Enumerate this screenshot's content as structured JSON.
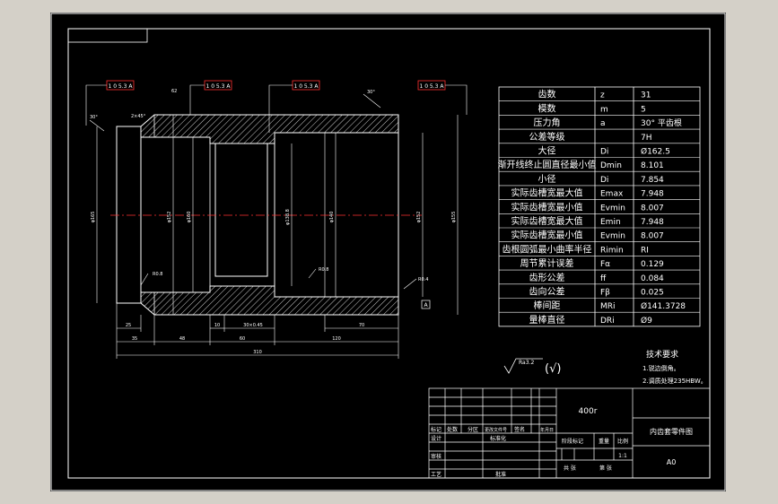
{
  "colors": {
    "background": "#000000",
    "line": "#ffffff",
    "center_line": "#ff0000",
    "tag_border": "#ff0000",
    "window_frame": "#d4d0c8"
  },
  "callouts": [
    "1 0 5.3 A",
    "1 0 5.3 A",
    "1 0 5.3 A",
    "1 0 5.3 A"
  ],
  "drawing_annotations": {
    "angle_left": "30°",
    "angle_right": "30°",
    "chamfer_left": "2×45°",
    "top_dim": "62",
    "r1": "R0.8",
    "r2": "R0.8",
    "r3": "R0.4",
    "datum": "A"
  },
  "dimensions": {
    "vertical": [
      "φ165",
      "φ152",
      "φ160",
      "φ138.8",
      "φ140",
      "φ152",
      "φ155"
    ],
    "horizontal": [
      "25",
      "35",
      "48",
      "60",
      "10",
      "30×0.45",
      "120",
      "70",
      "310"
    ]
  },
  "spec_table": [
    [
      "齿数",
      "z",
      "31"
    ],
    [
      "模数",
      "m",
      "5"
    ],
    [
      "压力角",
      "a",
      "30° 平齿根"
    ],
    [
      "公差等级",
      "",
      "7H"
    ],
    [
      "大径",
      "Di",
      "Ø162.5"
    ],
    [
      "渐开线终止圆直径最小值",
      "Dmin",
      "8.101"
    ],
    [
      "小径",
      "Di",
      "7.854"
    ],
    [
      "实际齿槽宽最大值",
      "Emax",
      "7.948"
    ],
    [
      "实际齿槽宽最小值",
      "Evmin",
      "8.007"
    ],
    [
      "实际齿槽宽最大值",
      "Emin",
      "7.948"
    ],
    [
      "实际齿槽宽最小值",
      "Evmin",
      "8.007"
    ],
    [
      "齿根圆弧最小曲率半径",
      "Rimin",
      "RI"
    ],
    [
      "周节累计误差",
      "Fα",
      "0.129"
    ],
    [
      "齿形公差",
      "ff",
      "0.084"
    ],
    [
      "齿向公差",
      "Fβ",
      "0.025"
    ],
    [
      "棒间距",
      "MRi",
      "Ø141.3728"
    ],
    [
      "量棒直径",
      "DRi",
      "Ø9"
    ]
  ],
  "tech_requirements": {
    "title": "技术要求",
    "items": [
      "1.锐边倒角。",
      "2.调质处理235HBW。"
    ]
  },
  "roughness": {
    "value": "Ra3.2",
    "note": "(√)"
  },
  "title_block": {
    "weight": "400r",
    "part_name": "内齿套零件图",
    "sheet_size": "A0",
    "scale": "1:1",
    "labels": {
      "mark": "标记",
      "count": "处数",
      "zone": "分区",
      "change_doc": "更改文件号",
      "signature": "签名",
      "date": "年月日",
      "design": "设计",
      "standardize": "标准化",
      "stage_mark": "阶段标记",
      "weight_label": "重量",
      "scale_label": "比例",
      "review": "审核",
      "process": "工艺",
      "approve": "批准",
      "sheets_total": "共 张",
      "sheet_no": "第 张"
    }
  }
}
